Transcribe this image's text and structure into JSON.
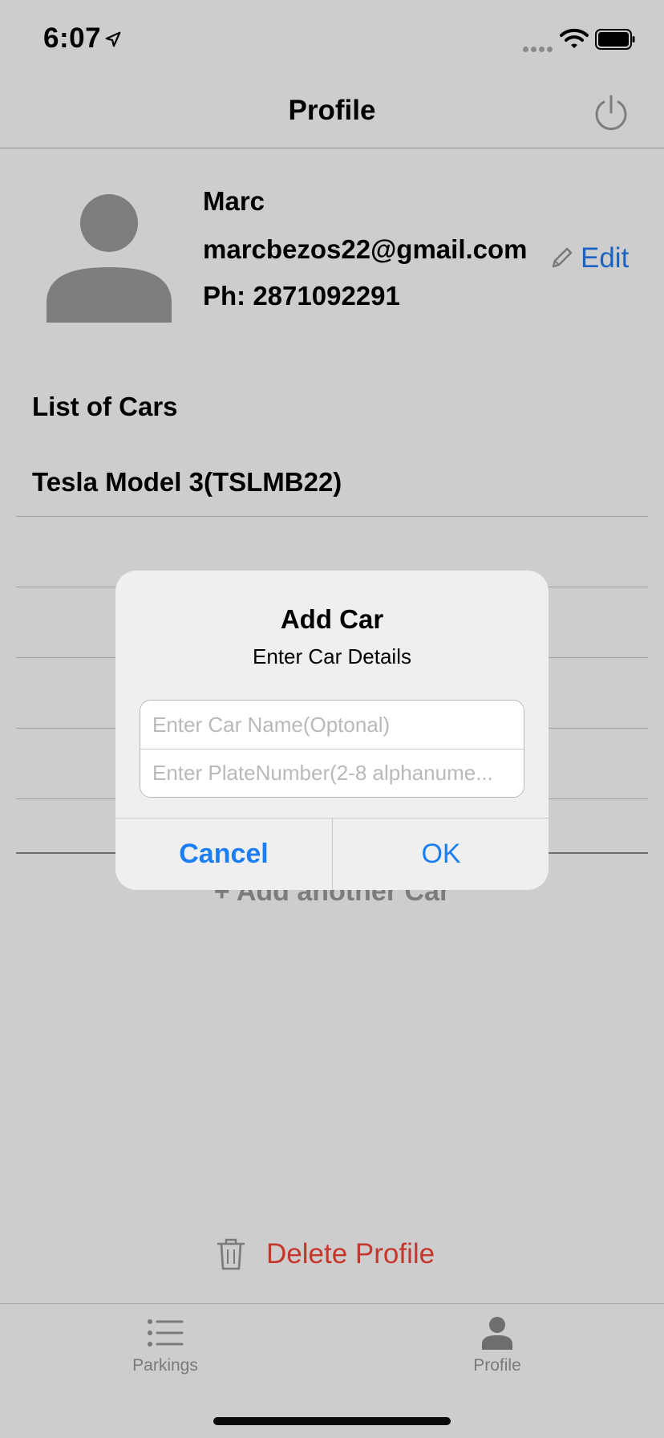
{
  "status_bar": {
    "time": "6:07"
  },
  "nav": {
    "title": "Profile"
  },
  "profile": {
    "name": "Marc",
    "email": "marcbezos22@gmail.com",
    "phone": "Ph: 2871092291",
    "edit_label": "Edit"
  },
  "cars": {
    "header": "List of Cars",
    "items": [
      {
        "label": "Tesla Model 3(TSLMB22)"
      }
    ],
    "add_label": "+ Add another Car"
  },
  "delete": {
    "label": "Delete Profile"
  },
  "tabs": [
    {
      "label": "Parkings",
      "icon": "list-icon"
    },
    {
      "label": "Profile",
      "icon": "person-icon"
    }
  ],
  "alert": {
    "title": "Add Car",
    "message": "Enter Car Details",
    "field1_placeholder": "Enter Car Name(Optonal)",
    "field2_placeholder": "Enter PlateNumber(2-8 alphanume...",
    "cancel_label": "Cancel",
    "ok_label": "OK"
  },
  "colors": {
    "accent": "#1b7ef2",
    "link": "#1b64c4",
    "destructive": "#c6362c",
    "dim_background": "#cdcdcd"
  }
}
